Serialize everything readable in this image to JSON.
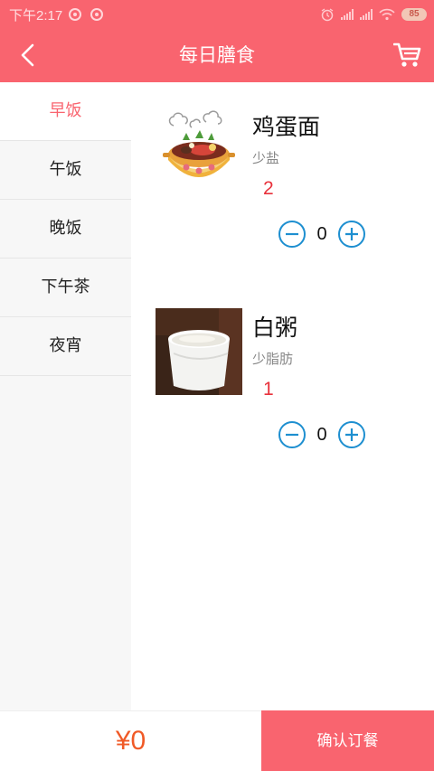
{
  "status_bar": {
    "time": "下午2:17",
    "battery": "85"
  },
  "header": {
    "title": "每日膳食",
    "back_icon": "chevron-left-icon",
    "cart_icon": "cart-icon"
  },
  "sidebar": {
    "items": [
      {
        "label": "早饭",
        "active": true
      },
      {
        "label": "午饭",
        "active": false
      },
      {
        "label": "晚饭",
        "active": false
      },
      {
        "label": "下午茶",
        "active": false
      },
      {
        "label": "夜宵",
        "active": false
      }
    ]
  },
  "dishes": [
    {
      "name": "鸡蛋面",
      "note": "少盐",
      "price": "2",
      "quantity": "0"
    },
    {
      "name": "白粥",
      "note": "少脂肪",
      "price": "1",
      "quantity": "0"
    }
  ],
  "footer": {
    "total": "¥0",
    "confirm_label": "确认订餐"
  },
  "colors": {
    "accent": "#f9646f",
    "price": "#e8313b",
    "total": "#f05a27",
    "stepper": "#1e8fd0"
  }
}
